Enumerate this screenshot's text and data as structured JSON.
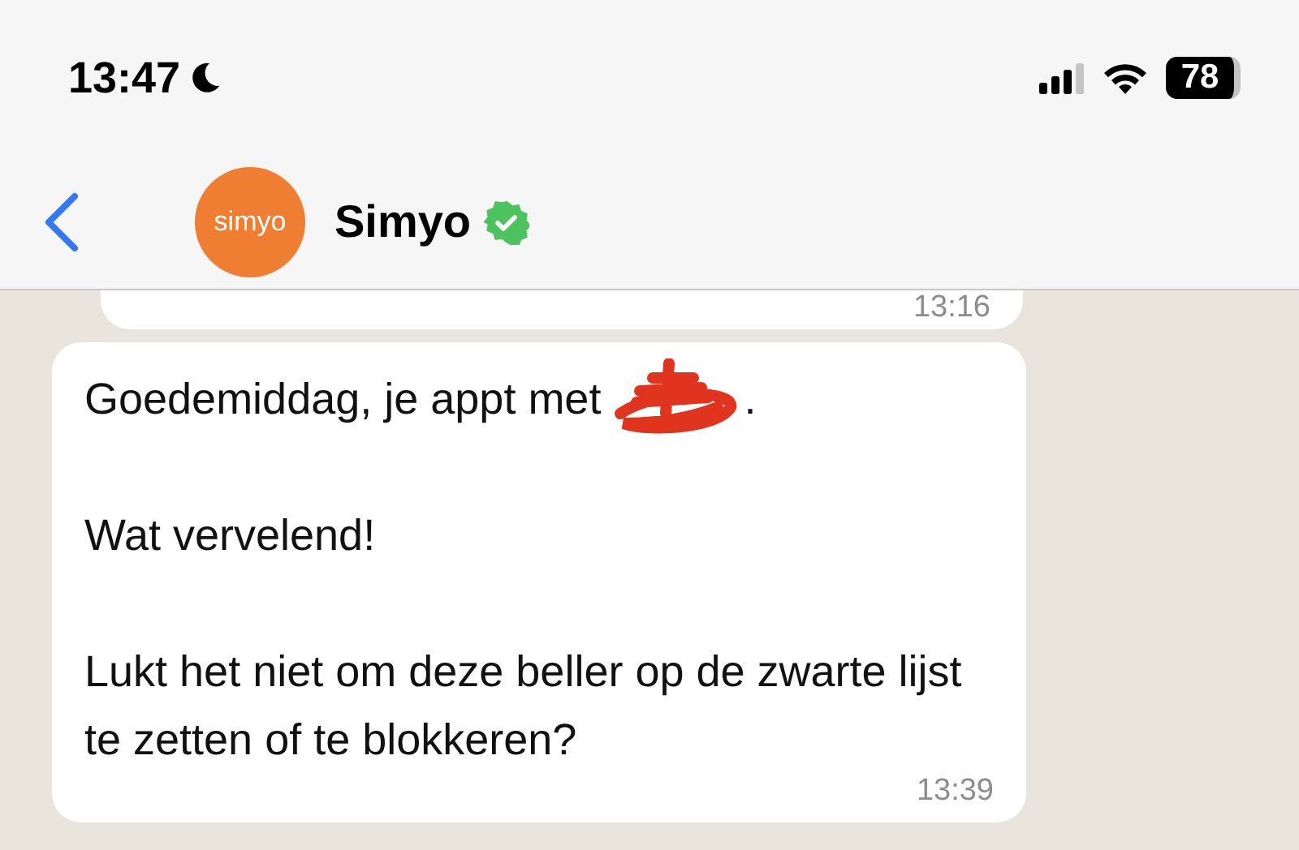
{
  "status_bar": {
    "time": "13:47",
    "focus_mode": true,
    "battery": "78"
  },
  "header": {
    "contact_name": "Simyo",
    "avatar_text": "simyo",
    "verified": true
  },
  "messages": [
    {
      "kind": "cut",
      "time": "13:16"
    },
    {
      "kind": "full",
      "time": "13:39",
      "paragraphs": [
        {
          "text": "Goedemiddag, je appt met",
          "redacted": true,
          "after_redaction": "."
        },
        {
          "text": "Wat vervelend!",
          "redacted": false
        },
        {
          "text": "Lukt het niet om deze beller op de zwarte lijst te zetten of te blokkeren?",
          "redacted": false
        }
      ]
    }
  ]
}
